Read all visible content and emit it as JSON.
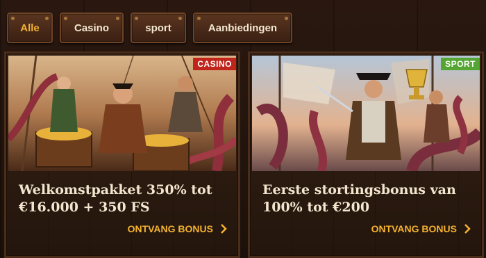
{
  "tabs": [
    {
      "label": "Alle",
      "active": true
    },
    {
      "label": "Casino",
      "active": false
    },
    {
      "label": "sport",
      "active": false
    },
    {
      "label": "Aanbiedingen",
      "active": false
    }
  ],
  "cards": [
    {
      "badge": "CASINO",
      "badge_color": "#c0241b",
      "image_desc": "pirates-treasure",
      "title_line1": "Welkomstpakket 350% tot",
      "title_line2": "€16.000 + 350 FS",
      "cta": "ONTVANG BONUS"
    },
    {
      "badge": "SPORT",
      "badge_color": "#54a532",
      "image_desc": "pirate-kraken-trophy",
      "title_line1": "Eerste stortingsbonus van",
      "title_line2": "100% tot €200",
      "cta": "ONTVANG BONUS"
    }
  ],
  "colors": {
    "accent": "#f5b331",
    "text": "#f3e6cf"
  }
}
